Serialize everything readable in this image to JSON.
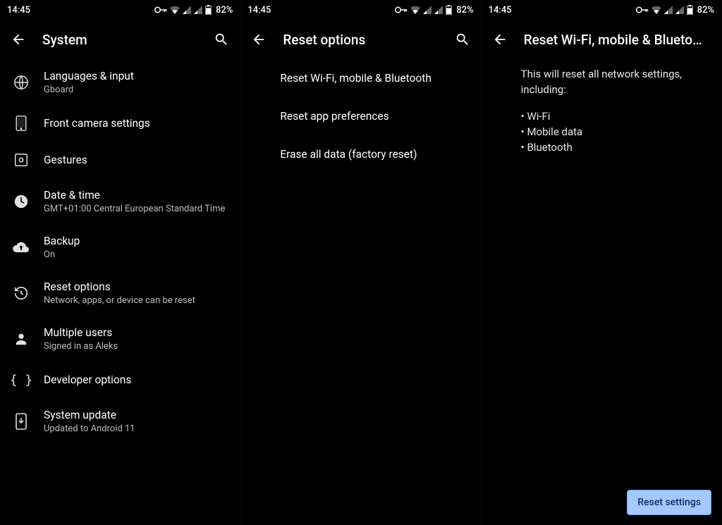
{
  "status": {
    "time": "14:45",
    "battery_pct": "82%"
  },
  "screen1": {
    "title": "System",
    "items": [
      {
        "title": "Languages & input",
        "sub": "Gboard"
      },
      {
        "title": "Front camera settings",
        "sub": ""
      },
      {
        "title": "Gestures",
        "sub": ""
      },
      {
        "title": "Date & time",
        "sub": "GMT+01:00 Central European Standard Time"
      },
      {
        "title": "Backup",
        "sub": "On"
      },
      {
        "title": "Reset options",
        "sub": "Network, apps, or device can be reset"
      },
      {
        "title": "Multiple users",
        "sub": "Signed in as Aleks"
      },
      {
        "title": "Developer options",
        "sub": ""
      },
      {
        "title": "System update",
        "sub": "Updated to Android 11"
      }
    ]
  },
  "screen2": {
    "title": "Reset options",
    "items": [
      "Reset Wi-Fi, mobile & Bluetooth",
      "Reset app preferences",
      "Erase all data (factory reset)"
    ]
  },
  "screen3": {
    "title": "Reset Wi-Fi, mobile & Blueto…",
    "intro": "This will reset all network settings, including:",
    "bullets": [
      "Wi-Fi",
      "Mobile data",
      "Bluetooth"
    ],
    "cta": "Reset settings"
  }
}
